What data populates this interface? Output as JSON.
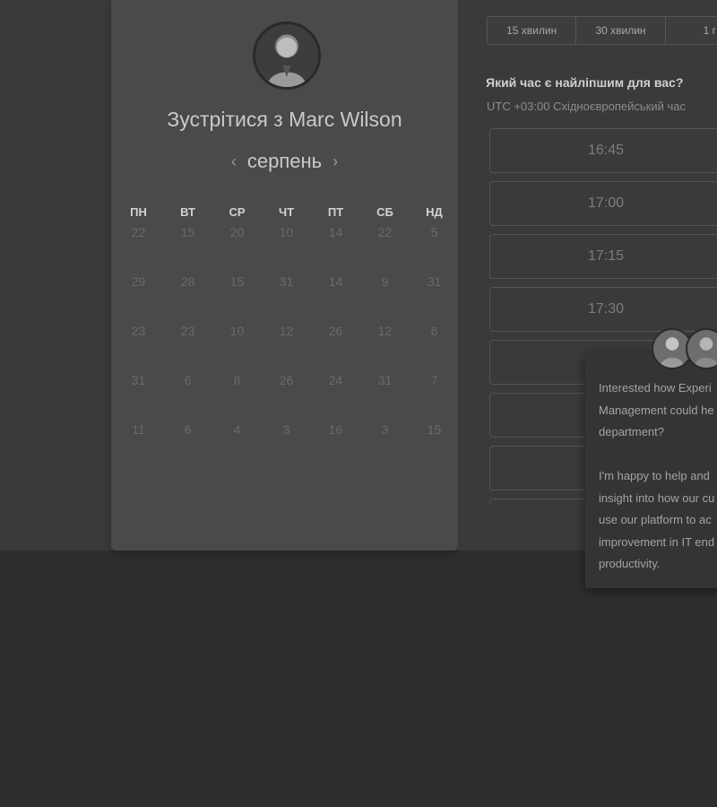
{
  "scheduler": {
    "title": "Зустрітися з Marc Wilson",
    "month": "серпень",
    "prev_icon": "‹",
    "next_icon": "›",
    "weekdays": [
      "ПН",
      "ВТ",
      "СР",
      "ЧТ",
      "ПТ",
      "СБ",
      "НД"
    ],
    "weeks": [
      [
        "22",
        "15",
        "20",
        "10",
        "14",
        "22",
        "5"
      ],
      [
        "29",
        "28",
        "15",
        "31",
        "14",
        "9",
        "31"
      ],
      [
        "23",
        "23",
        "10",
        "12",
        "26",
        "12",
        "6"
      ],
      [
        "31",
        "6",
        "8",
        "26",
        "24",
        "31",
        "7"
      ],
      [
        "11",
        "6",
        "4",
        "3",
        "16",
        "3",
        "15"
      ]
    ]
  },
  "duration": {
    "tabs": [
      "15 хвилин",
      "30 хвилин",
      "1 г"
    ]
  },
  "times": {
    "question": "Який час є найліпшим для вас?",
    "timezone": "UTC +03:00 Східноєвропейський час",
    "slots": [
      "16:45",
      "17:00",
      "17:15",
      "17:30",
      "",
      "",
      "",
      ""
    ]
  },
  "chat": {
    "message": "Interested how Experi\nManagement could he\ndepartment?\n\nI'm happy to help and\ninsight into how our cu\nuse our platform to ac\nimprovement in IT end\nproductivity."
  }
}
